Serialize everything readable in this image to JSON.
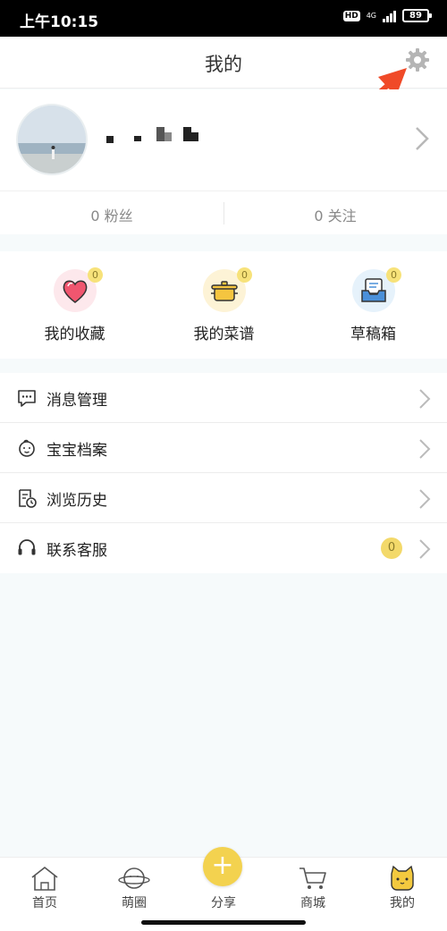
{
  "status_bar": {
    "time": "上午10:15",
    "hd": "HD",
    "network": "4G",
    "battery": "89"
  },
  "header": {
    "title": "我的",
    "settings_icon": "gear-icon"
  },
  "profile": {
    "avatar_icon": "avatar"
  },
  "stats": {
    "fans": "0 粉丝",
    "following": "0 关注"
  },
  "shortcuts": [
    {
      "label": "我的收藏",
      "count": "0",
      "icon": "heart-icon",
      "bg": "#fde8ec"
    },
    {
      "label": "我的菜谱",
      "count": "0",
      "icon": "pot-icon",
      "bg": "#fdf3d6"
    },
    {
      "label": "草稿箱",
      "count": "0",
      "icon": "draft-box-icon",
      "bg": "#e6f2fb"
    }
  ],
  "menu": [
    {
      "label": "消息管理",
      "icon": "message-icon"
    },
    {
      "label": "宝宝档案",
      "icon": "baby-icon"
    },
    {
      "label": "浏览历史",
      "icon": "history-icon"
    },
    {
      "label": "联系客服",
      "icon": "headset-icon",
      "badge": "0"
    }
  ],
  "tabbar": [
    {
      "label": "首页",
      "icon": "home-icon"
    },
    {
      "label": "萌圈",
      "icon": "planet-icon"
    },
    {
      "label": "分享",
      "icon": "plus-icon"
    },
    {
      "label": "商城",
      "icon": "cart-icon"
    },
    {
      "label": "我的",
      "icon": "cat-icon"
    }
  ],
  "colors": {
    "accent": "#f3d24f",
    "arrow": "#f04a28",
    "background": "#f6fafb"
  }
}
